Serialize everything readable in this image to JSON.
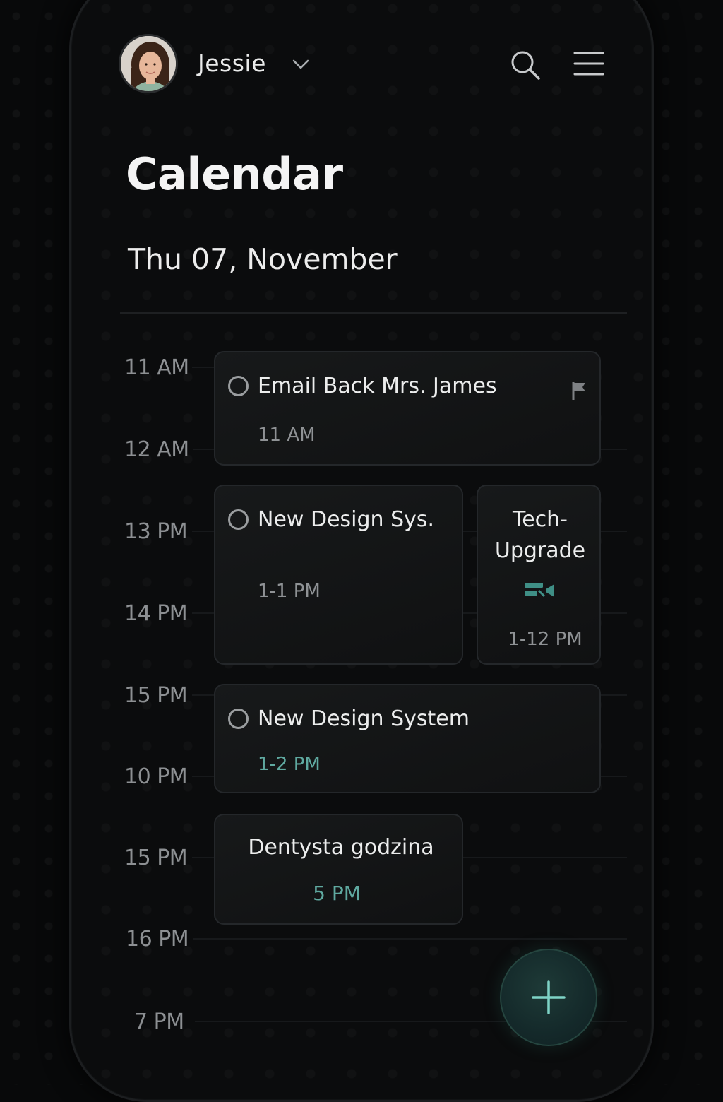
{
  "header": {
    "user_name": "Jessie",
    "avatar_icon": "user-avatar",
    "dropdown_icon": "chevron-down-icon",
    "search_icon": "search-icon",
    "menu_icon": "hamburger-menu-icon"
  },
  "page": {
    "title": "Calendar",
    "date": "Thu 07, November"
  },
  "timeline": {
    "hours": [
      "11 AM",
      "12 AM",
      "13 PM",
      "14 PM",
      "15 PM",
      "10 PM",
      "15 PM",
      "16 PM",
      "7 PM"
    ]
  },
  "events": [
    {
      "title": "Email Back Mrs. James",
      "time": "11 AM",
      "flagged": true
    },
    {
      "title": "New Design Sys.",
      "time": "1-1 PM"
    },
    {
      "title_line1": "Tech-",
      "title_line2": "Upgrade",
      "time": "1-12 PM",
      "icon": "video-call-icon"
    },
    {
      "title": "New Design System",
      "time": "1-2 PM"
    },
    {
      "title": "Dentysta godzina",
      "time": "5 PM"
    }
  ],
  "fab": {
    "icon": "plus-icon"
  },
  "colors": {
    "background": "#0b0c0d",
    "card": "#151718",
    "accent": "#5fa9a0",
    "text": "#eceded",
    "muted": "#8f9295"
  }
}
